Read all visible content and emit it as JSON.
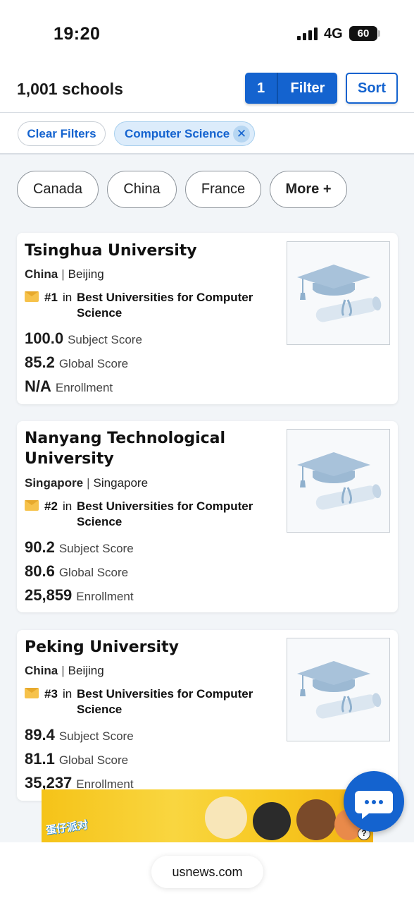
{
  "status_bar": {
    "time": "19:20",
    "network": "4G",
    "battery": "60"
  },
  "header": {
    "result_count": "1,001 schools",
    "filter_count": "1",
    "filter_label": "Filter",
    "sort_label": "Sort"
  },
  "active_filters": {
    "clear_label": "Clear Filters",
    "chip_label": "Computer Science",
    "chip_close": "✕"
  },
  "country_chips": [
    "Canada",
    "China",
    "France",
    "More +"
  ],
  "schools": [
    {
      "name": "Tsinghua University",
      "country": "China",
      "city": "Beijing",
      "rank": "#1",
      "rank_in": "in",
      "rank_list": "Best Universities for Computer Science",
      "subject_score": "100.0",
      "subject_score_label": "Subject Score",
      "global_score": "85.2",
      "global_score_label": "Global Score",
      "enrollment": "N/A",
      "enrollment_label": "Enrollment",
      "thumbnail_icon": "graduation-cap-icon"
    },
    {
      "name": "Nanyang Technological University",
      "country": "Singapore",
      "city": "Singapore",
      "rank": "#2",
      "rank_in": "in",
      "rank_list": "Best Universities for Computer Science",
      "subject_score": "90.2",
      "subject_score_label": "Subject Score",
      "global_score": "80.6",
      "global_score_label": "Global Score",
      "enrollment": "25,859",
      "enrollment_label": "Enrollment",
      "thumbnail_icon": "graduation-cap-icon"
    },
    {
      "name": "Peking University",
      "country": "China",
      "city": "Beijing",
      "rank": "#3",
      "rank_in": "in",
      "rank_list": "Best Universities for Computer Science",
      "subject_score": "89.4",
      "subject_score_label": "Subject Score",
      "global_score": "81.1",
      "global_score_label": "Global Score",
      "enrollment": "35,237",
      "enrollment_label": "Enrollment",
      "thumbnail_icon": "graduation-cap-icon"
    }
  ],
  "ad": {
    "text": "蛋仔派对",
    "help": "?"
  },
  "chat": {
    "icon": "chat-bubble-icon"
  },
  "url_bar": {
    "url": "usnews.com"
  },
  "colors": {
    "accent": "#1463cf",
    "chip_bg": "#dcecfb",
    "page_bg": "#f2f5f8"
  }
}
